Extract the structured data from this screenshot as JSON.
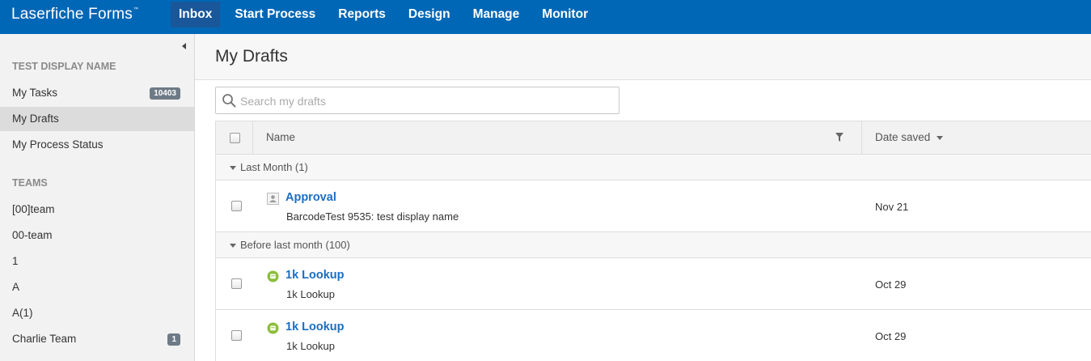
{
  "app": {
    "brand": "Laserfiche Forms",
    "brand_mark": "™"
  },
  "nav": {
    "items": [
      {
        "label": "Inbox",
        "active": true
      },
      {
        "label": "Start Process"
      },
      {
        "label": "Reports"
      },
      {
        "label": "Design"
      },
      {
        "label": "Manage"
      },
      {
        "label": "Monitor"
      }
    ]
  },
  "sidebar": {
    "user_heading": "TEST DISPLAY NAME",
    "items": [
      {
        "label": "My Tasks",
        "badge": "10403"
      },
      {
        "label": "My Drafts",
        "active": true
      },
      {
        "label": "My Process Status"
      }
    ],
    "teams_heading": "TEAMS",
    "teams": [
      {
        "label": "[00]team"
      },
      {
        "label": "00-team"
      },
      {
        "label": "1"
      },
      {
        "label": "A"
      },
      {
        "label": "A(1)"
      },
      {
        "label": "Charlie Team",
        "badge": "1"
      }
    ]
  },
  "main": {
    "title": "My Drafts",
    "search": {
      "placeholder": "Search my drafts",
      "value": ""
    },
    "columns": {
      "name": "Name",
      "date": "Date saved"
    },
    "groups": [
      {
        "label": "Last Month (1)",
        "rows": [
          {
            "title": "Approval",
            "subtitle": "BarcodeTest 9535: test display name",
            "date": "Nov 21",
            "icon": "user-form-icon"
          }
        ]
      },
      {
        "label": "Before last month (100)",
        "rows": [
          {
            "title": "1k Lookup",
            "subtitle": "1k Lookup",
            "date": "Oct 29",
            "icon": "process-icon"
          },
          {
            "title": "1k Lookup",
            "subtitle": "1k Lookup",
            "date": "Oct 29",
            "icon": "process-icon"
          }
        ]
      }
    ]
  },
  "colors": {
    "topbar": "#0067b6",
    "nav_active": "#19579a",
    "link": "#1b6ec2",
    "badge": "#6e7a85",
    "process_icon": "#8cbe3c"
  }
}
